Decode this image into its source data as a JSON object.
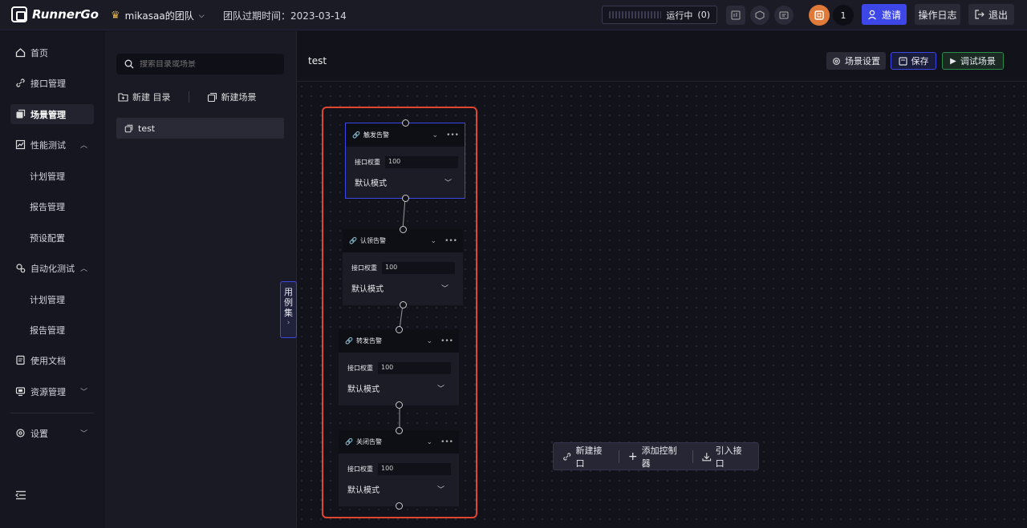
{
  "app": {
    "name": "RunnerGo"
  },
  "topbar": {
    "team_name": "mikasaa的团队",
    "expire_label": "团队过期时间：2023-03-14",
    "running_label": "运行中",
    "running_count": "(0)",
    "user_count": "1",
    "invite_label": "邀请",
    "oplog_label": "操作日志",
    "logout_label": "退出"
  },
  "sidebar": {
    "items": [
      {
        "label": "首页",
        "icon": "home-icon"
      },
      {
        "label": "接口管理",
        "icon": "link-icon"
      },
      {
        "label": "场景管理",
        "icon": "scene-icon"
      },
      {
        "label": "性能测试",
        "icon": "chart-icon"
      },
      {
        "label": "计划管理"
      },
      {
        "label": "报告管理"
      },
      {
        "label": "预设配置"
      },
      {
        "label": "自动化测试",
        "icon": "gears-icon"
      },
      {
        "label": "计划管理"
      },
      {
        "label": "报告管理"
      },
      {
        "label": "使用文档",
        "icon": "doc-icon"
      },
      {
        "label": "资源管理",
        "icon": "monitor-icon"
      },
      {
        "label": "设置",
        "icon": "settings-icon"
      }
    ]
  },
  "tree": {
    "search_placeholder": "搜索目录或场景",
    "new_folder_label": "新建 目录",
    "new_scene_label": "新建场景",
    "items": [
      {
        "label": "test"
      }
    ],
    "case_set_label": [
      "用",
      "例",
      "集"
    ]
  },
  "main": {
    "title": "test",
    "scene_settings_label": "场景设置",
    "save_label": "保存",
    "debug_label": "调试场景"
  },
  "nodes": [
    {
      "name": "触发告警",
      "weight_label": "接口权重",
      "weight_value": "100",
      "mode": "默认模式"
    },
    {
      "name": "认领告警",
      "weight_label": "接口权重",
      "weight_value": "100",
      "mode": "默认模式"
    },
    {
      "name": "转发告警",
      "weight_label": "接口权重",
      "weight_value": "100",
      "mode": "默认模式"
    },
    {
      "name": "关闭告警",
      "weight_label": "接口权重",
      "weight_value": "100",
      "mode": "默认模式"
    }
  ],
  "canvas_toolbar": {
    "new_api_label": "新建接口",
    "add_controller_label": "添加控制器",
    "import_api_label": "引入接口"
  },
  "colors": {
    "accent": "#3d46e6",
    "highlight": "#e0452f",
    "debug": "#2c8a4a",
    "avatar": "#e07a3a"
  }
}
